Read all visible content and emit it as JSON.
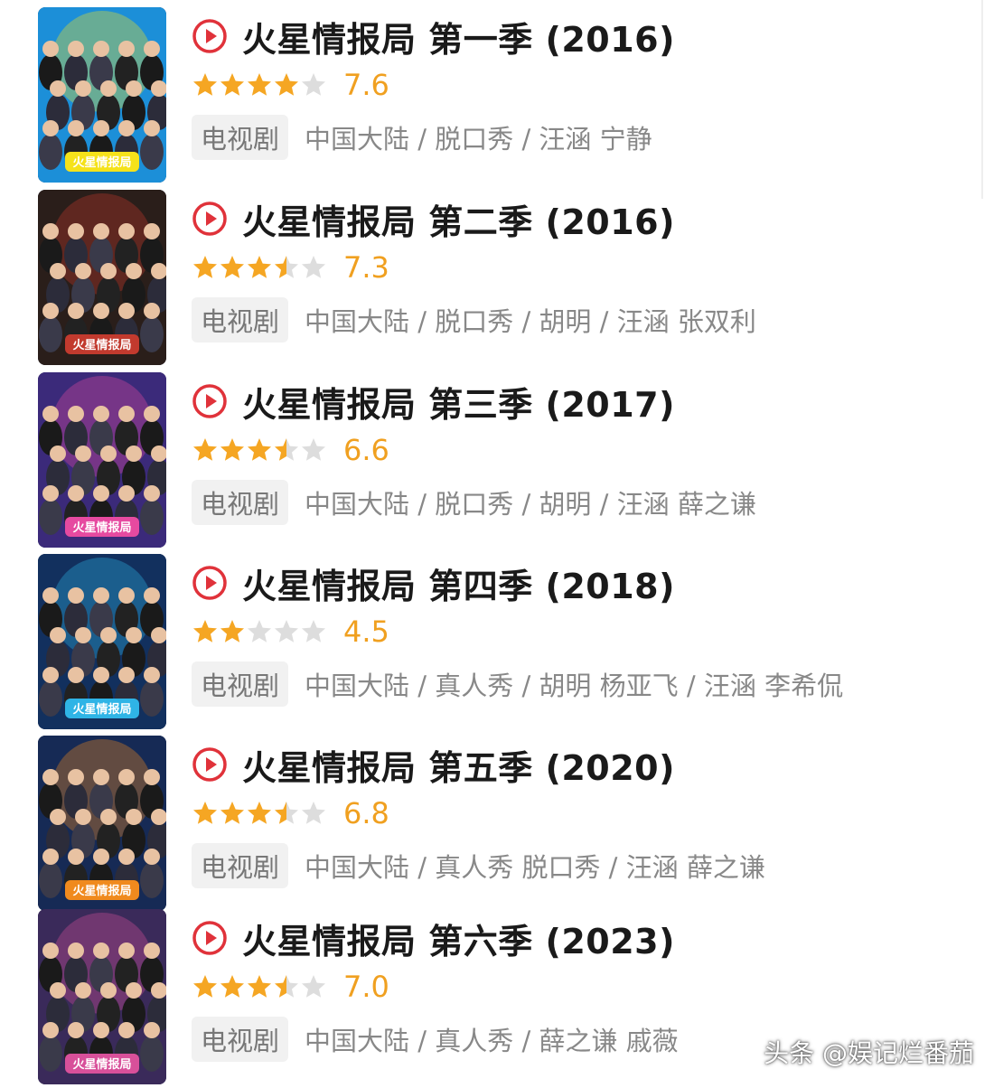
{
  "items": [
    {
      "title": "火星情报局 第一季 (2016)",
      "score": "7.6",
      "stars": [
        "full",
        "full",
        "full",
        "full",
        "empty"
      ],
      "tag": "电视剧",
      "meta": "中国大陆 / 脱口秀 / 汪涵 宁静",
      "poster": {
        "bg": "#1c8fd8",
        "accent": "#f5e21a",
        "logo": "火星情报局"
      }
    },
    {
      "title": "火星情报局 第二季 (2016)",
      "score": "7.3",
      "stars": [
        "full",
        "full",
        "full",
        "half",
        "empty"
      ],
      "tag": "电视剧",
      "meta": "中国大陆 / 脱口秀 / 胡明 / 汪涵 张双利",
      "poster": {
        "bg": "#2a1e1a",
        "accent": "#c23a2e",
        "logo": "火星情报局"
      }
    },
    {
      "title": "火星情报局 第三季 (2017)",
      "score": "6.6",
      "stars": [
        "full",
        "full",
        "full",
        "half",
        "empty"
      ],
      "tag": "电视剧",
      "meta": "中国大陆 / 脱口秀 / 胡明 / 汪涵 薛之谦",
      "poster": {
        "bg": "#3b2a7a",
        "accent": "#e64aa0",
        "logo": "火星情报局"
      }
    },
    {
      "title": "火星情报局 第四季 (2018)",
      "score": "4.5",
      "stars": [
        "full",
        "full",
        "empty",
        "empty",
        "empty"
      ],
      "tag": "电视剧",
      "meta": "中国大陆 / 真人秀 / 胡明 杨亚飞 / 汪涵 李希侃",
      "poster": {
        "bg": "#12305e",
        "accent": "#2fb4e6",
        "logo": "火星情报局"
      }
    },
    {
      "title": "火星情报局 第五季 (2020)",
      "score": "6.8",
      "stars": [
        "full",
        "full",
        "full",
        "half",
        "empty"
      ],
      "tag": "电视剧",
      "meta": "中国大陆 / 真人秀 脱口秀 / 汪涵 薛之谦",
      "poster": {
        "bg": "#162a55",
        "accent": "#f08a1e",
        "logo": "火星情报局"
      }
    },
    {
      "title": "火星情报局 第六季 (2023)",
      "score": "7.0",
      "stars": [
        "full",
        "full",
        "full",
        "half",
        "empty"
      ],
      "tag": "电视剧",
      "meta": "中国大陆 / 真人秀 / 薛之谦 戚薇",
      "poster": {
        "bg": "#3a2a5a",
        "accent": "#d8509a",
        "logo": "火星情报局"
      }
    }
  ],
  "icons": {
    "play": "play-circle-icon",
    "star_full": "star-full-icon",
    "star_half": "star-half-icon",
    "star_empty": "star-empty-icon"
  },
  "colors": {
    "play_red": "#e0323a",
    "star_gold": "#f5a623",
    "star_grey": "#dddddd",
    "score": "#f0a020"
  },
  "watermark": "头条 @娱记烂番茄"
}
